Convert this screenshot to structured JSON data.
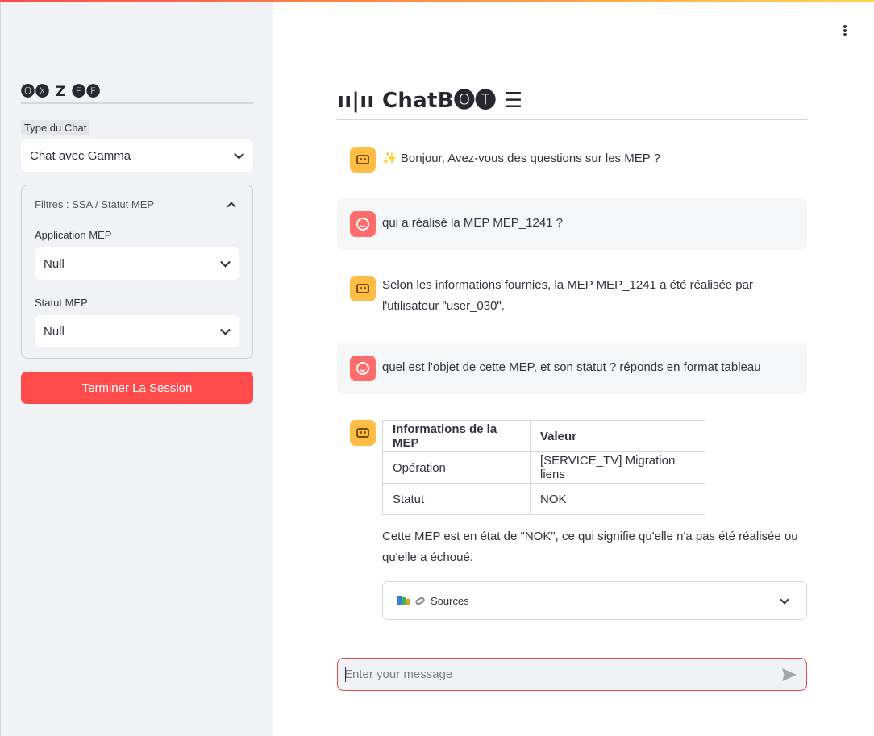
{
  "sidebar": {
    "logo": "🅞🅧 Z 🅔🅔",
    "chat_type_label": "Type du Chat",
    "chat_type_value": "Chat avec Gamma",
    "filters": {
      "title": "Filtres : SSA / Statut MEP",
      "app_label": "Application MEP",
      "app_value": "Null",
      "status_label": "Statut MEP",
      "status_value": "Null"
    },
    "end_button": "Terminer La Session"
  },
  "main": {
    "title": "ıı|ıı ChatB🅞🅣 ☰",
    "messages": [
      {
        "role": "assistant",
        "text": "✨ Bonjour, Avez-vous des questions sur les MEP ?"
      },
      {
        "role": "user",
        "text": "qui a réalisé la MEP MEP_1241 ?"
      },
      {
        "role": "assistant",
        "text": "Selon les informations fournies, la MEP MEP_1241 a été réalisée par l'utilisateur \"user_030\"."
      },
      {
        "role": "user",
        "text": "quel est l'objet de cette MEP, et son statut ? réponds en format tableau"
      },
      {
        "role": "assistant",
        "text": "Cette MEP est en état de \"NOK\", ce qui signifie qu'elle n'a pas été réalisée ou qu'elle a échoué."
      }
    ],
    "table": {
      "headers": [
        "Informations de la MEP",
        "Valeur"
      ],
      "rows": [
        [
          "Opération",
          "[SERVICE_TV] Migration liens"
        ],
        [
          "Statut",
          "NOK"
        ]
      ]
    },
    "sources_label": "Sources",
    "input_placeholder": "Enter your message"
  },
  "colors": {
    "accent": "#ff4b4b",
    "sidebar_bg": "#f0f2f6",
    "bot_avatar": "#ffbd45",
    "user_avatar": "#ff6c6c"
  },
  "icons": {
    "menu": "vertical-dots-icon",
    "send": "send-icon",
    "bot": "robot-icon",
    "user": "user-face-icon",
    "sources": [
      "books-icon",
      "link-icon"
    ]
  }
}
